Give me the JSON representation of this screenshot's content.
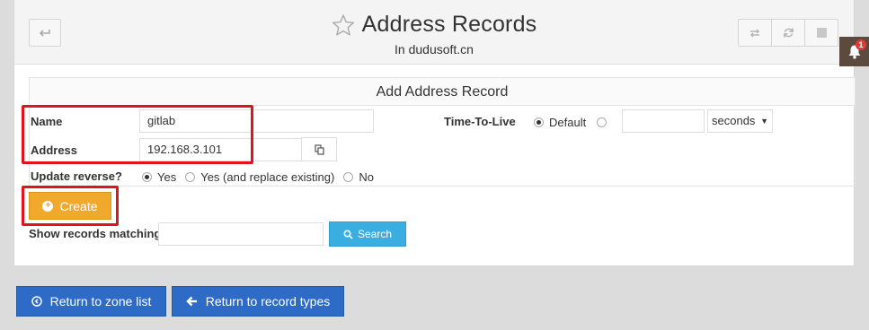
{
  "header": {
    "title": "Address Records",
    "subtitle": "In dudusoft.cn",
    "notification_count": "1"
  },
  "form": {
    "title": "Add Address Record",
    "name_label": "Name",
    "name_value": "gitlab",
    "address_label": "Address",
    "address_value": "192.168.3.101",
    "ttl_label": "Time-To-Live",
    "ttl_default": "Default",
    "ttl_value": "",
    "ttl_unit": "seconds",
    "reverse_label": "Update reverse?",
    "reverse_options": [
      "Yes",
      "Yes (and replace existing)",
      "No"
    ],
    "reverse_selected": "Yes",
    "create_label": "Create"
  },
  "search": {
    "label": "Show records matching:",
    "value": "",
    "button_label": "Search"
  },
  "footer": {
    "return_zone_label": "Return to zone list",
    "return_types_label": "Return to record types"
  },
  "colors": {
    "highlight": "#e1141e",
    "create": "#f0a92a",
    "search": "#3aaee0",
    "nav_button": "#2e6bc6",
    "bell_bg": "#5d4a3f"
  }
}
